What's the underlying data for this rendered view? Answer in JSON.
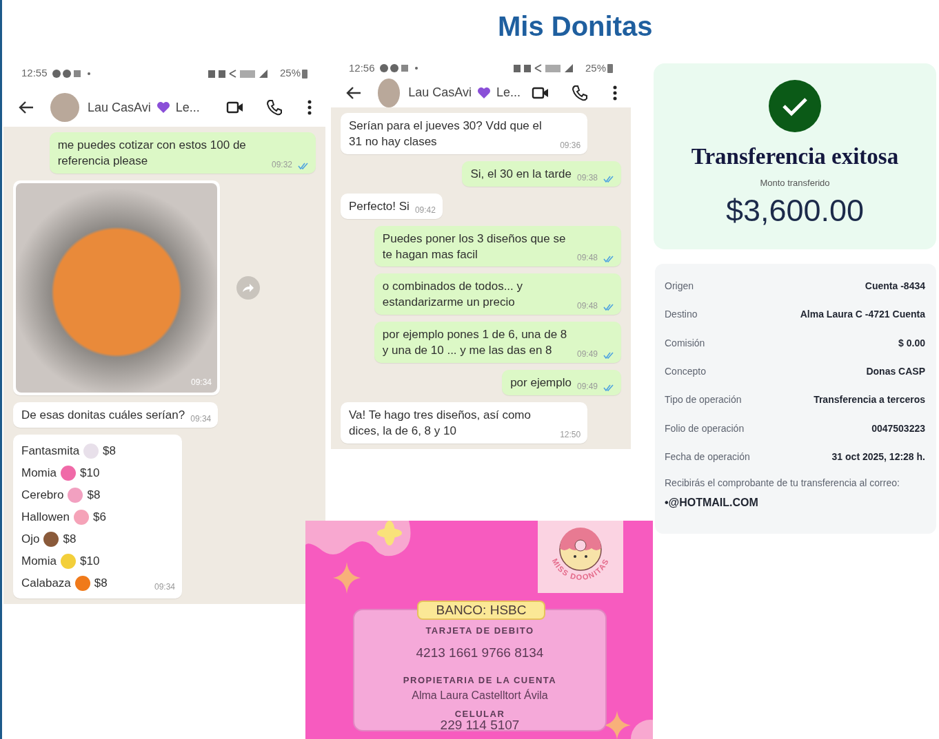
{
  "slide_title": "Mis Donitas",
  "chats": [
    {
      "status_time": "12:55",
      "battery": "25%",
      "contact_name": "Lau CasAvi",
      "contact_name_rest": "Le...",
      "messages": [
        {
          "kind": "text",
          "outgoing": true,
          "text": "me puedes cotizar con estos 100 de referencia please",
          "time": "09:32"
        },
        {
          "kind": "image",
          "outgoing": false,
          "time": "09:34"
        },
        {
          "kind": "text",
          "outgoing": false,
          "text": "De esas donitas cuáles serían?",
          "time": "09:34"
        },
        {
          "kind": "list",
          "outgoing": false,
          "time": "09:34",
          "items": [
            {
              "name": "Fantasmita",
              "price": "$8"
            },
            {
              "name": "Momia",
              "price": "$10"
            },
            {
              "name": "Cerebro",
              "price": "$8"
            },
            {
              "name": "Hallowen",
              "price": "$6"
            },
            {
              "name": "Ojo",
              "price": "$8"
            },
            {
              "name": "Momia",
              "price": "$10"
            },
            {
              "name": "Calabaza",
              "price": "$8"
            }
          ]
        }
      ]
    },
    {
      "status_time": "12:56",
      "battery": "25%",
      "contact_name": "Lau CasAvi",
      "contact_name_rest": "Le...",
      "messages": [
        {
          "kind": "text",
          "outgoing": false,
          "text": "Serían para el jueves 30? Vdd que el 31 no hay clases",
          "time": "09:36"
        },
        {
          "kind": "text",
          "outgoing": true,
          "text": "Si, el 30 en la tarde",
          "time": "09:38"
        },
        {
          "kind": "text",
          "outgoing": false,
          "text": "Perfecto! Si",
          "time": "09:42"
        },
        {
          "kind": "text",
          "outgoing": true,
          "text": "Puedes poner los 3 diseños que se te hagan mas facil",
          "time": "09:48"
        },
        {
          "kind": "text",
          "outgoing": true,
          "text": "o combinados de todos... y estandarizarme un precio",
          "time": "09:48"
        },
        {
          "kind": "text",
          "outgoing": true,
          "text": "por ejemplo pones 1 de 6, una de 8 y una de 10 ... y me las das en 8",
          "time": "09:49"
        },
        {
          "kind": "text",
          "outgoing": true,
          "text": "por ejemplo",
          "time": "09:49"
        },
        {
          "kind": "text",
          "outgoing": false,
          "text": "Va! Te hago tres diseños, así como dices, la de 6, 8 y 10",
          "time": "12:50"
        }
      ]
    }
  ],
  "transfer": {
    "title": "Transferencia exitosa",
    "amount_label": "Monto transferido",
    "amount": "$3,600.00"
  },
  "details": {
    "rows": [
      {
        "label": "Origen",
        "value": "Cuenta -8434"
      },
      {
        "label": "Destino",
        "value": "Alma Laura C -4721 Cuenta"
      },
      {
        "label": "Comisión",
        "value": "$ 0.00"
      },
      {
        "label": "Concepto",
        "value": "Donas CASP"
      },
      {
        "label": "Tipo de operación",
        "value": "Transferencia a terceros"
      },
      {
        "label": "Folio de operación",
        "value": "0047503223"
      },
      {
        "label": "Fecha de operación",
        "value": "31 oct 2025, 12:28 h."
      }
    ],
    "note": "Recibirás el comprobante de tu transferencia al correo:",
    "email": "•@HOTMAIL.COM"
  },
  "bank_card": {
    "logo_text": "MISS DOONITAS",
    "bank": "BANCO: HSBC",
    "card_label": "TARJETA DE DEBITO",
    "card_number": "4213 1661 9766 8134",
    "owner_label": "PROPIETARIA DE LA CUENTA",
    "owner": "Alma Laura Castelltort Ávila",
    "phone_label": "CELULAR",
    "phone": "229 114 5107"
  }
}
